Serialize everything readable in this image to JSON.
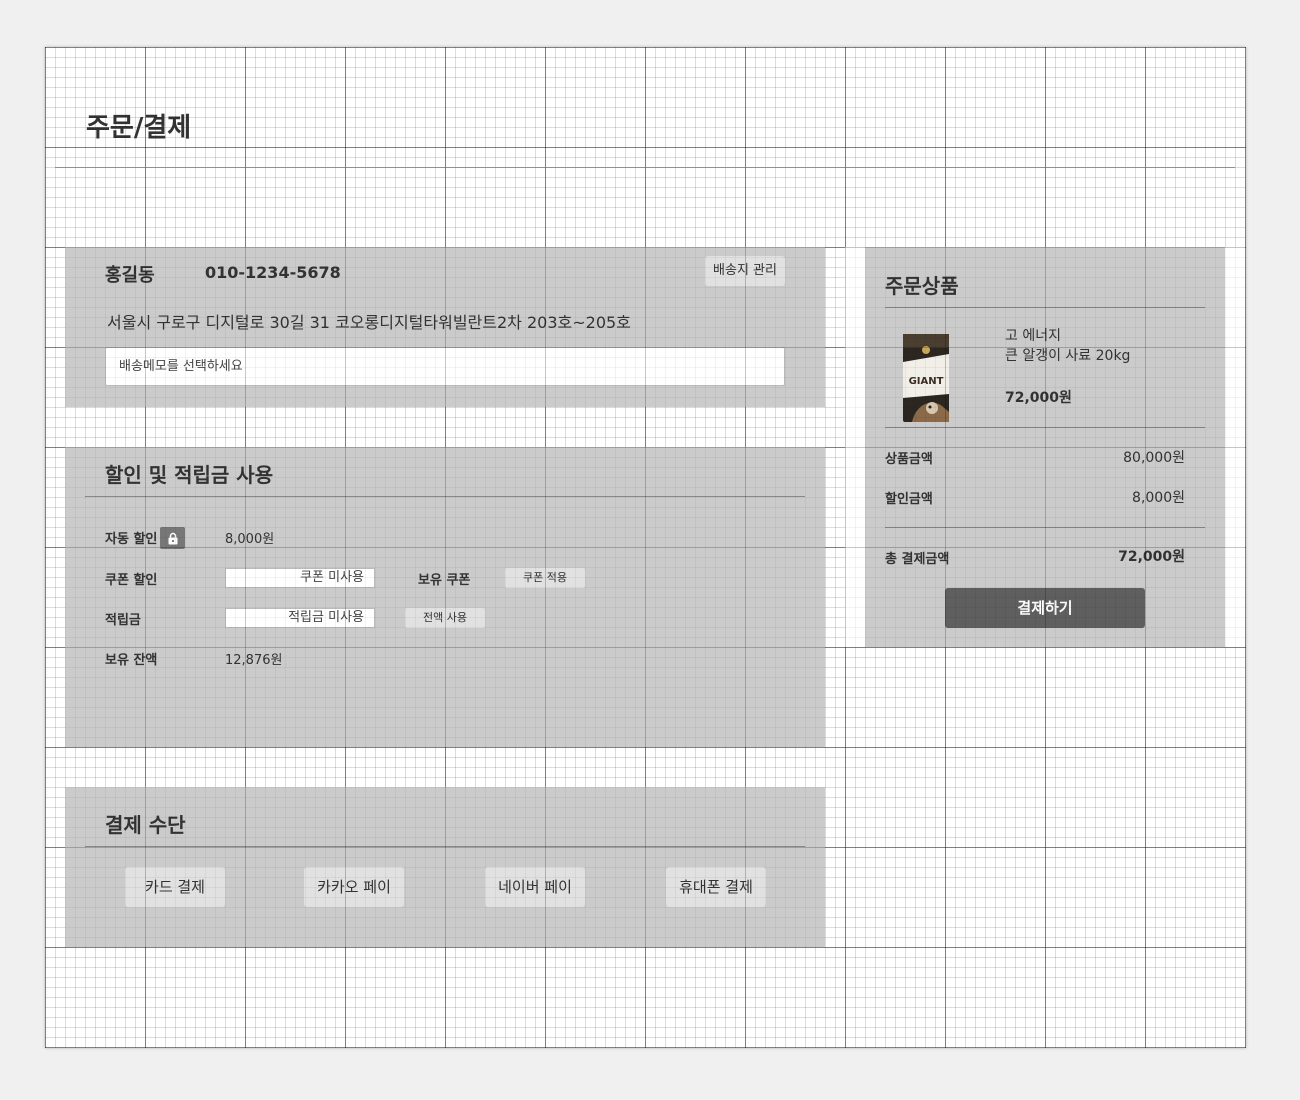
{
  "page": {
    "title": "주문/결제"
  },
  "shipping": {
    "name": "홍길동",
    "phone": "010-1234-5678",
    "manage_button": "배송지 관리",
    "address": "서울시 구로구 디지털로 30길 31 코오롱디지털타워빌란트2차 203호~205호",
    "memo_placeholder": "배송메모를 선택하세요"
  },
  "discount": {
    "title": "할인 및 적립금 사용",
    "auto_label": "자동 할인",
    "auto_value": "8,000원",
    "coupon_label": "쿠폰 할인",
    "coupon_value": "쿠폰 미사용",
    "owned_coupon_label": "보유 쿠폰",
    "apply_coupon_button": "쿠폰 적용",
    "points_label": "적립금",
    "points_value": "적립금 미사용",
    "use_all_button": "전액 사용",
    "balance_label": "보유 잔액",
    "balance_value": "12,876원"
  },
  "payment": {
    "title": "결제 수단",
    "methods": [
      "카드 결제",
      "카카오 페이",
      "네이버 페이",
      "휴대폰 결제"
    ]
  },
  "order": {
    "title": "주문상품",
    "product": {
      "brand": "고 에너지",
      "name": "큰 알갱이 사료 20kg",
      "price": "72,000원",
      "package_text": "GIANT"
    },
    "subtotal_label": "상품금액",
    "subtotal_value": "80,000원",
    "discount_label": "할인금액",
    "discount_value": "8,000원",
    "total_label": "총 결제금액",
    "total_value": "72,000원",
    "checkout_button": "결제하기"
  },
  "colors": {
    "panel": "#cbcbcb",
    "button": "#e1e1e1",
    "checkout": "#5f5f5f"
  }
}
